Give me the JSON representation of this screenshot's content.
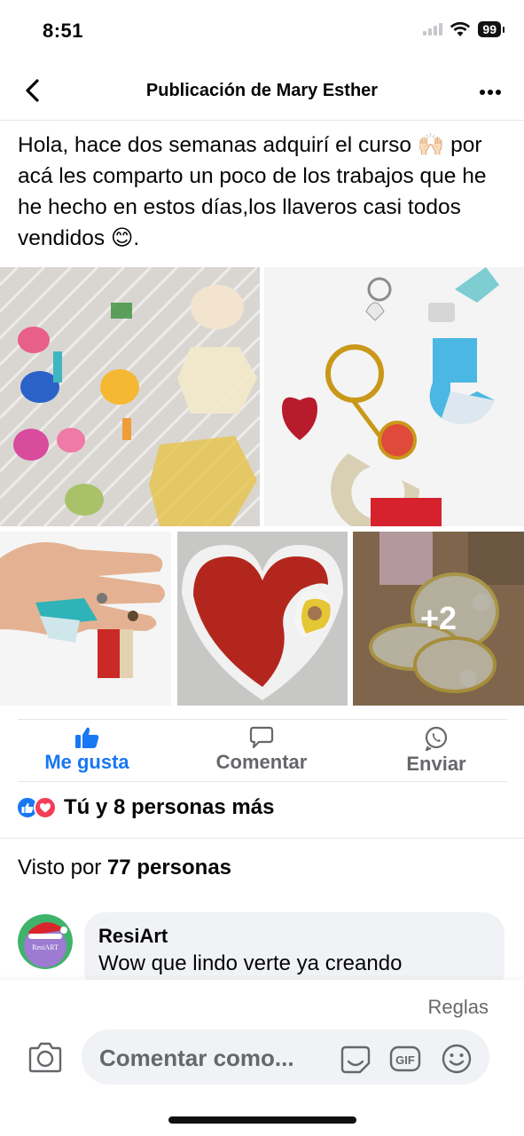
{
  "status_bar": {
    "time": "8:51",
    "battery": "99"
  },
  "nav": {
    "title": "Publicación de Mary Esther"
  },
  "post": {
    "text": "Hola, hace dos semanas adquirí el curso 🙌🏻 por acá les comparto un poco de los trabajos que he he hecho en estos días,los llaveros casi todos vendidos 😊.",
    "more_photos": "+2"
  },
  "actions": {
    "like": "Me gusta",
    "comment": "Comentar",
    "send": "Enviar"
  },
  "reactions": {
    "summary": "Tú y 8 personas más"
  },
  "seen": {
    "prefix": "Visto por ",
    "count": "77 personas"
  },
  "comment": {
    "author": "ResiArt",
    "text": "Wow que lindo verte ya creando",
    "avatar_text": "ResiART"
  },
  "composer": {
    "rules": "Reglas",
    "placeholder": "Comentar como...",
    "gif": "GIF"
  },
  "colors": {
    "accent": "#1877f2",
    "secondary_text": "#65676b",
    "reaction_love": "#f33e58"
  }
}
